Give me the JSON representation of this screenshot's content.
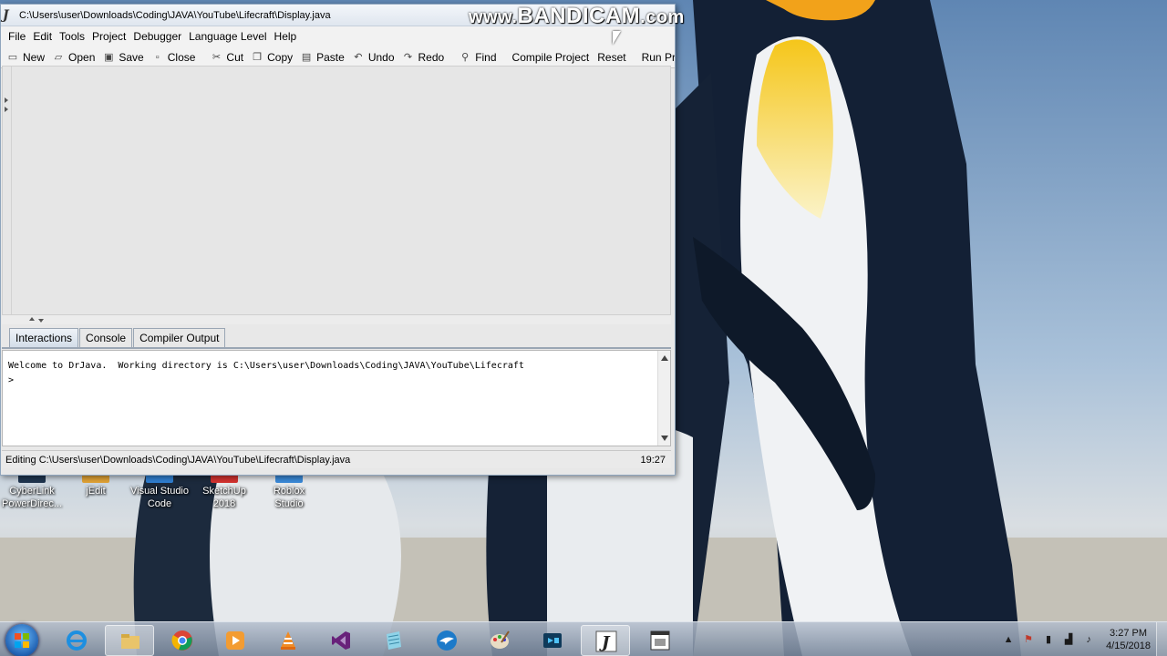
{
  "window": {
    "title": "C:\\Users\\user\\Downloads\\Coding\\JAVA\\YouTube\\Lifecraft\\Display.java",
    "app_icon": "J"
  },
  "menubar": {
    "items": [
      {
        "label": "File"
      },
      {
        "label": "Edit"
      },
      {
        "label": "Tools"
      },
      {
        "label": "Project"
      },
      {
        "label": "Debugger"
      },
      {
        "label": "Language Level"
      },
      {
        "label": "Help"
      }
    ]
  },
  "toolbar": {
    "new": "New",
    "open": "Open",
    "save": "Save",
    "close": "Close",
    "cut": "Cut",
    "copy": "Copy",
    "paste": "Paste",
    "undo": "Undo",
    "redo": "Redo",
    "find": "Find",
    "compile_project": "Compile Project",
    "reset": "Reset",
    "run_project": "Run Pro"
  },
  "tabs": {
    "interactions": "Interactions",
    "console": "Console",
    "compiler_output": "Compiler Output",
    "active": "Interactions"
  },
  "interactions": {
    "welcome": "Welcome to DrJava.  Working directory is C:\\Users\\user\\Downloads\\Coding\\JAVA\\YouTube\\Lifecraft",
    "prompt": ">"
  },
  "statusbar": {
    "editing": "Editing C:\\Users\\user\\Downloads\\Coding\\JAVA\\YouTube\\Lifecraft\\Display.java",
    "position": "19:27"
  },
  "watermark": {
    "prefix": "www.",
    "brand": "BANDICAM",
    "suffix": ".com"
  },
  "desktop_icons": [
    {
      "line1": "CyberLink",
      "line2": "PowerDirec..."
    },
    {
      "line1": "jEdit",
      "line2": ""
    },
    {
      "line1": "Visual Studio",
      "line2": "Code"
    },
    {
      "line1": "SketchUp",
      "line2": "2018"
    },
    {
      "line1": "Roblox",
      "line2": "Studio"
    }
  ],
  "taskbar": {
    "apps": [
      "internet-explorer",
      "file-explorer",
      "chrome",
      "media-player",
      "vlc",
      "visual-studio",
      "notepad",
      "swift",
      "paint",
      "camtasia",
      "drjava",
      "file-viewer"
    ],
    "active_app": "drjava"
  },
  "clock": {
    "time": "3:27 PM",
    "date": "4/15/2018"
  },
  "colors": {
    "accent": "#1f5fb0",
    "window_bg": "#e8e8e8"
  }
}
